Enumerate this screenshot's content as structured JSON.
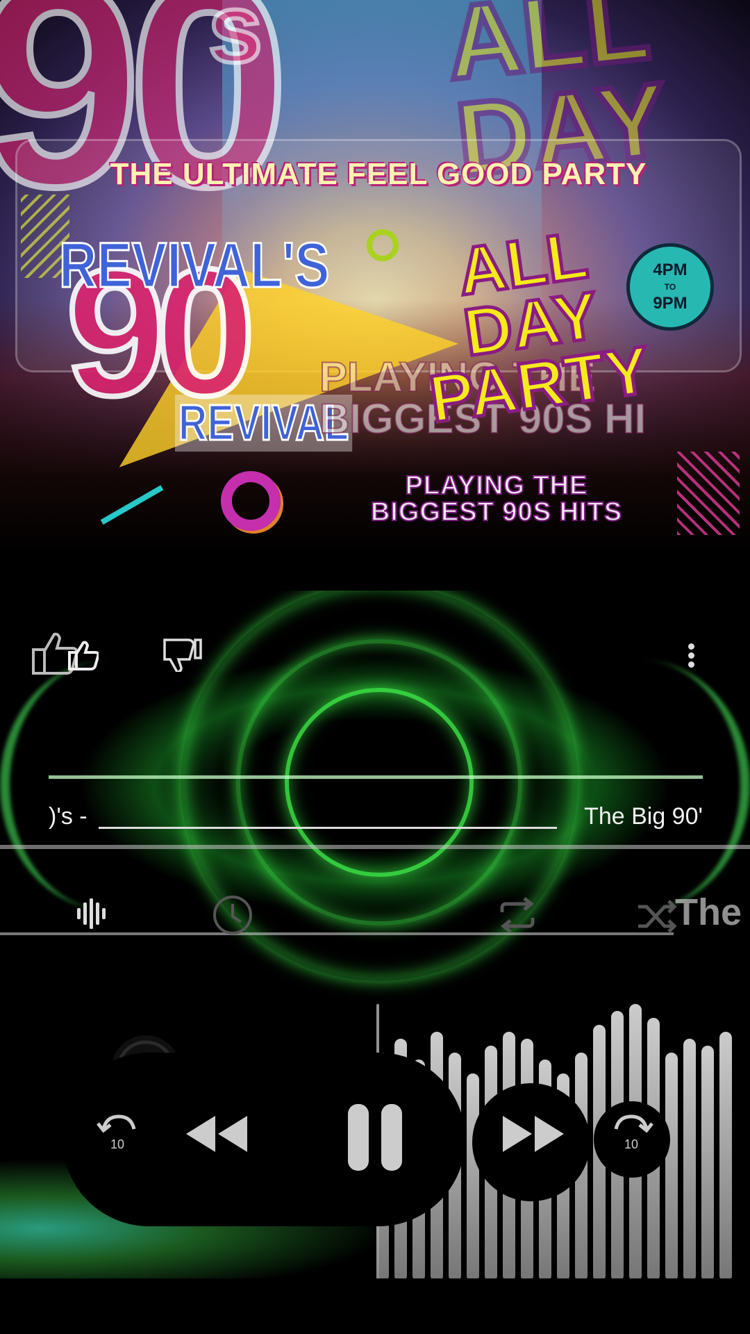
{
  "poster": {
    "ghost_90": "90",
    "ghost_s": "s",
    "ghost_all_day": "ALL DAY",
    "tagline": "THE ULTIMATE FEEL GOOD PARTY",
    "revivals": "REVIVAL'S",
    "big_90": "90",
    "revival": "REVIVAL",
    "all_day_party": "ALL DAY PARTY",
    "time_from": "4PM",
    "time_to": "TO",
    "time_end": "9PM",
    "ghost_playing": "PLAYING THE",
    "ghost_biggest": "BIGGEST 90S HI",
    "playing_line1": "PLAYING THE",
    "playing_line2": "BIGGEST 90S HITS"
  },
  "track": {
    "title_left": ")'s -",
    "title_right": "The Big 90'",
    "ghost_title": "The"
  },
  "icons": {
    "thumb_up": "thumbs-up-icon",
    "thumb_down": "thumbs-down-icon",
    "more": "more-vertical-icon",
    "equalizer": "equalizer-icon",
    "sleep_timer": "clock-icon",
    "repeat": "repeat-icon",
    "shuffle": "shuffle-icon",
    "rewind_10": "replay-10-icon",
    "previous": "rewind-icon",
    "pause": "pause-icon",
    "next": "fast-forward-icon",
    "forward_10": "forward-10-icon"
  },
  "controls": {
    "rewind_seconds": "10",
    "forward_seconds": "10"
  },
  "colors": {
    "visualizer_green": "#3ce646",
    "accent_pink": "#d9246e",
    "accent_yellow": "#f5ea1c"
  }
}
